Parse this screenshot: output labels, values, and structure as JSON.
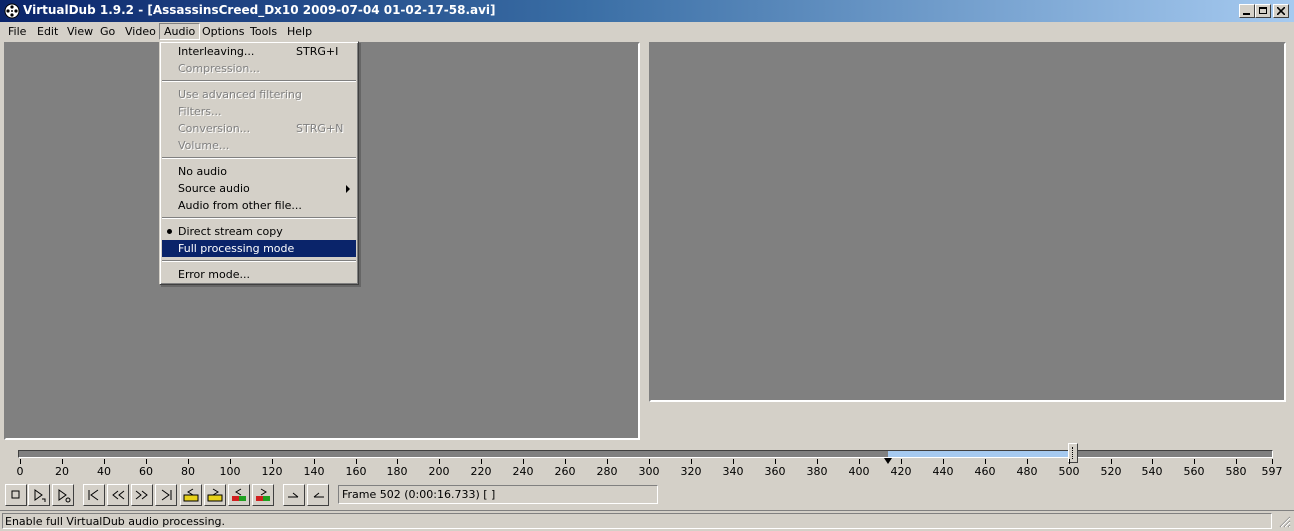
{
  "window": {
    "title": "VirtualDub 1.9.2 - [AssassinsCreed_Dx10 2009-07-04 01-02-17-58.avi]",
    "icon": "film-reel-icon"
  },
  "menubar": {
    "items": [
      "File",
      "Edit",
      "View",
      "Go",
      "Video",
      "Audio",
      "Options",
      "Tools",
      "Help"
    ],
    "open_item": "Audio"
  },
  "audio_menu": {
    "items": [
      {
        "label": "Interleaving...",
        "shortcut": "STRG+I",
        "enabled": true
      },
      {
        "label": "Compression...",
        "enabled": false
      },
      {
        "label": "Use advanced filtering",
        "enabled": false
      },
      {
        "label": "Filters...",
        "enabled": false
      },
      {
        "label": "Conversion...",
        "shortcut": "STRG+N",
        "enabled": false
      },
      {
        "label": "Volume...",
        "enabled": false
      },
      {
        "label": "No audio",
        "enabled": true
      },
      {
        "label": "Source audio",
        "enabled": true,
        "submenu": true
      },
      {
        "label": "Audio from other file...",
        "enabled": true
      },
      {
        "label": "Direct stream copy",
        "enabled": true,
        "checked": true
      },
      {
        "label": "Full processing mode",
        "enabled": true,
        "highlighted": true
      },
      {
        "label": "Error mode...",
        "enabled": true
      }
    ]
  },
  "timeline": {
    "min": 0,
    "max": 597,
    "current_frame": 502,
    "selection_start": 414,
    "selection_end": 502,
    "tick_labels": [
      "0",
      "20",
      "40",
      "60",
      "80",
      "100",
      "120",
      "140",
      "160",
      "180",
      "200",
      "220",
      "240",
      "260",
      "280",
      "300",
      "320",
      "340",
      "360",
      "380",
      "400",
      "420",
      "440",
      "460",
      "480",
      "500",
      "520",
      "540",
      "560",
      "580",
      "597"
    ]
  },
  "toolbar": {
    "buttons": [
      "stop-icon",
      "play-input-icon",
      "play-output-icon",
      "start-icon",
      "prev-keyframe-icon",
      "next-keyframe-icon",
      "end-icon",
      "scene-key-back-icon",
      "scene-key-fwd-icon",
      "scene-back-icon",
      "scene-fwd-icon",
      "mark-in-icon",
      "mark-out-icon"
    ],
    "frame_text": "Frame 502 (0:00:16.733) [ ]"
  },
  "status": {
    "text": "Enable full VirtualDub audio processing."
  },
  "colors": {
    "face": "#d4d0c8",
    "pane": "#808080",
    "highlight": "#0a246a",
    "selection": "#a6caf0"
  }
}
